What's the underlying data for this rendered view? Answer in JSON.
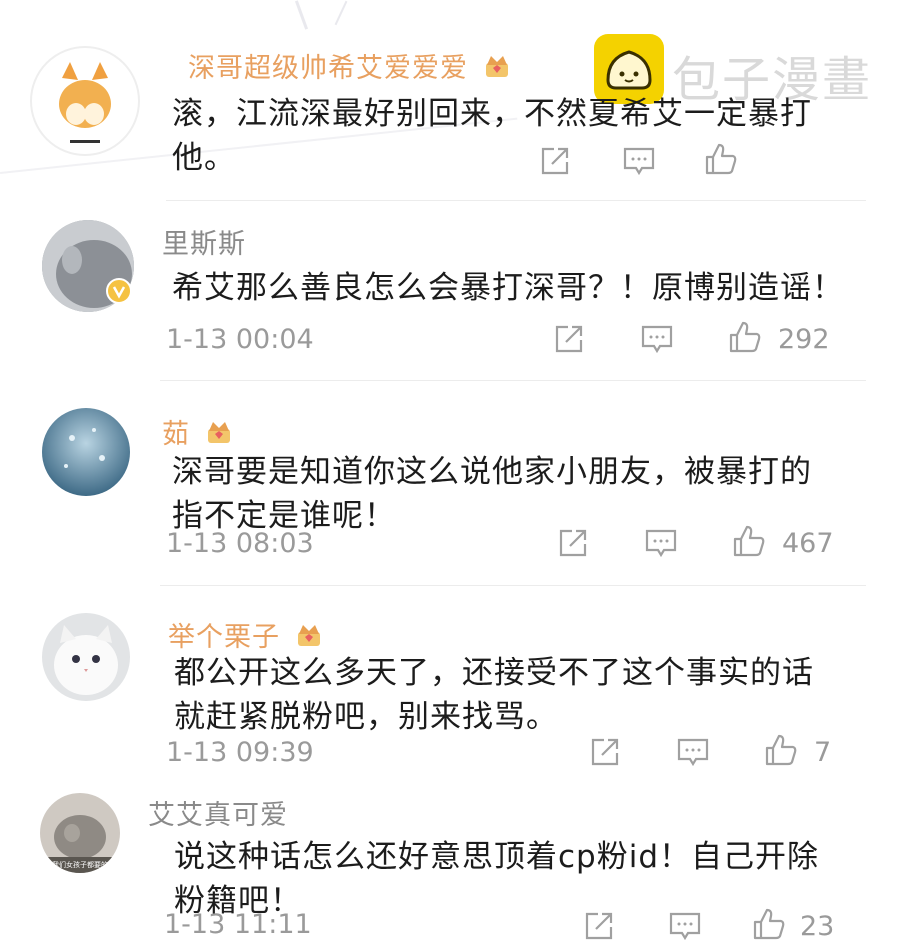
{
  "watermark": {
    "text": "包子漫畫"
  },
  "comments": [
    {
      "username": "深哥超级帅希艾爱爱爱",
      "user_style": "vip",
      "has_crown": true,
      "lines": [
        "滚，江流深最好别回来，不然夏希艾一定暴打",
        "他。"
      ],
      "time": "",
      "likes": ""
    },
    {
      "username": "里斯斯",
      "user_style": "plain",
      "has_crown": false,
      "lines": [
        "希艾那么善良怎么会暴打深哥？！原博别造谣！"
      ],
      "time": "1-13 00:04",
      "likes": "292"
    },
    {
      "username": "茹",
      "user_style": "vip",
      "has_crown": true,
      "lines": [
        "深哥要是知道你这么说他家小朋友，被暴打的",
        "指不定是谁呢！"
      ],
      "time": "1-13 08:03",
      "likes": "467"
    },
    {
      "username": "举个栗子",
      "user_style": "vip",
      "has_crown": true,
      "lines": [
        "都公开这么多天了，还接受不了这个事实的话",
        "就赶紧脱粉吧，别来找骂。"
      ],
      "time": "1-13 09:39",
      "likes": "7"
    },
    {
      "username": "艾艾真可爱",
      "user_style": "plain",
      "has_crown": false,
      "lines": [
        "说这种话怎么还好意思顶着cp粉id！自己开除",
        "粉籍吧！"
      ],
      "time": "1-13 11:11",
      "likes": "23"
    }
  ],
  "icons": {
    "share": "share-icon",
    "comment": "comment-icon",
    "like": "like-icon",
    "crown": "crown-badge-icon",
    "verified": "verified-badge-icon"
  }
}
